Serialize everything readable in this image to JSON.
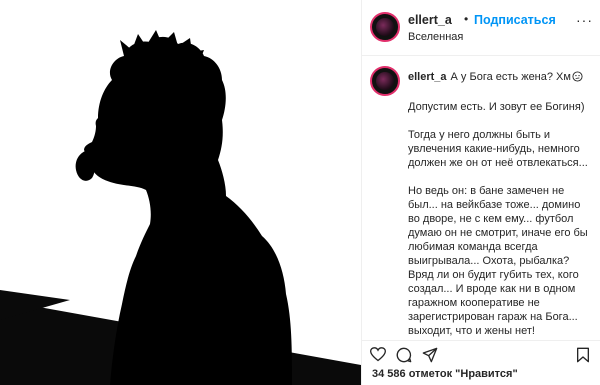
{
  "header": {
    "username": "ellert_a",
    "separator": "•",
    "follow_label": "Подписаться",
    "location": "Вселенная",
    "more_label": "···"
  },
  "caption": {
    "username": "ellert_a",
    "lines": [
      "А у Бога есть жена? Хм",
      "Допустим есть. И зовут ее Богиня)",
      "Тогда у него должны быть и увлечения какие-нибудь, немного должен же он от неё отвлекаться...",
      "Но ведь он: в бане замечен не был... на вейкбазе тоже... домино во дворе, не с кем ему... футбол думаю он не смотрит, иначе его бы любимая команда всегда выигрывала... Охота, рыбалка? Вряд ли он будит губить тех, кого создал... И вроде как ни в одном гаражном кооперативе не зарегистрирован гараж на Бога... выходит, что и жены нет!"
    ],
    "emoji_icon": "thinking-face-icon"
  },
  "actions": {
    "icons": [
      "heart-icon",
      "comment-icon",
      "share-icon",
      "bookmark-icon"
    ]
  },
  "likes_text": "34 586 отметок \"Нравится\"",
  "colors": {
    "follow": "#0095f6",
    "avatar_ring": "#e1306c",
    "text": "#262626",
    "divider": "#efefef"
  }
}
